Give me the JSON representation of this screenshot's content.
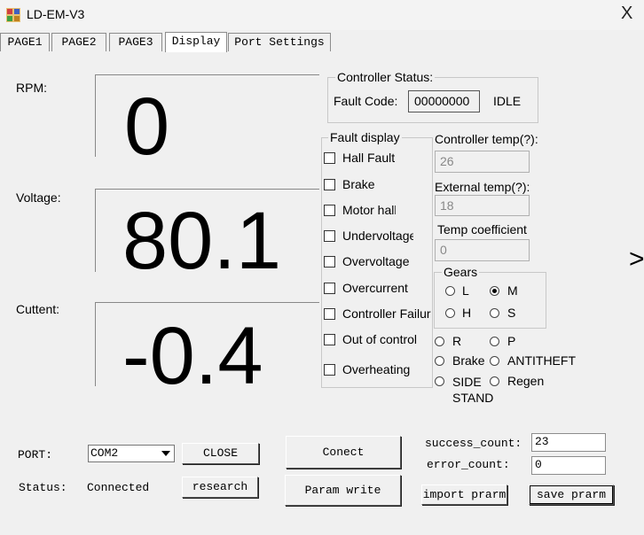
{
  "window": {
    "title": "LD-EM-V3",
    "close_glyph": "X"
  },
  "tabs": [
    {
      "label": "PAGE1"
    },
    {
      "label": "PAGE2"
    },
    {
      "label": "PAGE3"
    },
    {
      "label": "Display"
    },
    {
      "label": "Port Settings"
    }
  ],
  "gauges": {
    "rpm": {
      "label": "RPM:",
      "value": "0"
    },
    "voltage": {
      "label": "Voltage:",
      "value": "80.1"
    },
    "current": {
      "label": "Cuttent:",
      "value": "-0.4"
    }
  },
  "controller_status": {
    "title": "Controller Status:",
    "fault_code_label": "Fault Code:",
    "fault_code_value": "00000000",
    "state": "IDLE"
  },
  "fault_display": {
    "title": "Fault display",
    "items": [
      {
        "label": "Hall Fault",
        "checked": false
      },
      {
        "label": "Brake",
        "checked": false
      },
      {
        "label": "Motor hall",
        "checked": false
      },
      {
        "label": "Undervoltage",
        "checked": false
      },
      {
        "label": "Overvoltage",
        "checked": false
      },
      {
        "label": "Overcurrent",
        "checked": false
      },
      {
        "label": "Controller Failure",
        "checked": false
      },
      {
        "label": "Out of control",
        "checked": false
      },
      {
        "label": "Overheating",
        "checked": false
      }
    ]
  },
  "temps": {
    "controller_label": "Controller temp(?):",
    "controller_value": "26",
    "external_label": "External temp(?):",
    "external_value": "18",
    "coeff_label": "Temp coefficient",
    "coeff_value": "0"
  },
  "gears": {
    "title": "Gears",
    "options": [
      {
        "label": "L",
        "selected": false
      },
      {
        "label": "M",
        "selected": true
      },
      {
        "label": "H",
        "selected": false
      },
      {
        "label": "S",
        "selected": false
      }
    ]
  },
  "modes": [
    {
      "label": "R"
    },
    {
      "label": "P"
    },
    {
      "label": "Brake"
    },
    {
      "label": "ANTITHEFT"
    },
    {
      "label": "SIDE STAND"
    },
    {
      "label": "Regen"
    }
  ],
  "port": {
    "label": "PORT:",
    "selected": "COM2",
    "close_button": "CLOSE",
    "status_label": "Status:",
    "status_value": "Connected",
    "research_button": "research"
  },
  "actions": {
    "connect": "Conect",
    "param_write": "Param write",
    "import": "import prarm",
    "save": "save prarm"
  },
  "counters": {
    "success_label": "success_count:",
    "success_value": "23",
    "error_label": "error_count:",
    "error_value": "0"
  },
  "edge_glyph": ">"
}
